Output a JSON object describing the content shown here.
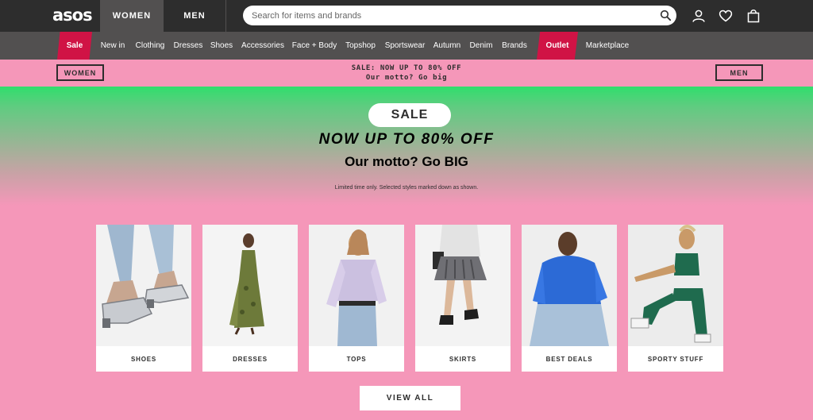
{
  "header": {
    "logo": "asos",
    "tabs": [
      {
        "label": "WOMEN"
      },
      {
        "label": "MEN"
      }
    ],
    "search_placeholder": "Search for items and brands",
    "icons": [
      "account-icon",
      "heart-icon",
      "bag-icon"
    ]
  },
  "nav": {
    "items": [
      {
        "label": "Sale"
      },
      {
        "label": "New in"
      },
      {
        "label": "Clothing"
      },
      {
        "label": "Dresses"
      },
      {
        "label": "Shoes"
      },
      {
        "label": "Accessories"
      },
      {
        "label": "Face + Body"
      },
      {
        "label": "Topshop"
      },
      {
        "label": "Sportswear"
      },
      {
        "label": "Autumn"
      },
      {
        "label": "Denim"
      },
      {
        "label": "Brands"
      },
      {
        "label": "Outlet"
      },
      {
        "label": "Marketplace"
      }
    ]
  },
  "promo": {
    "left_button": "WOMEN",
    "line1": "SALE: NOW UP TO 80% OFF",
    "line2": "Our motto? Go big",
    "right_button": "MEN"
  },
  "hero": {
    "pill": "SALE",
    "headline": "NOW UP TO 80% OFF",
    "subline": "Our motto? Go BIG",
    "fine_print": "Limited time only. Selected styles marked down as shown.",
    "cards": [
      {
        "label": "SHOES"
      },
      {
        "label": "DRESSES"
      },
      {
        "label": "TOPS"
      },
      {
        "label": "SKIRTS"
      },
      {
        "label": "BEST DEALS"
      },
      {
        "label": "SPORTY STUFF"
      }
    ],
    "view_all": "VIEW ALL"
  },
  "colors": {
    "header_bg": "#2d2d2d",
    "nav_bg": "#525050",
    "sale_red": "#d01345",
    "pink": "#f597b9",
    "green": "#30de6c"
  }
}
